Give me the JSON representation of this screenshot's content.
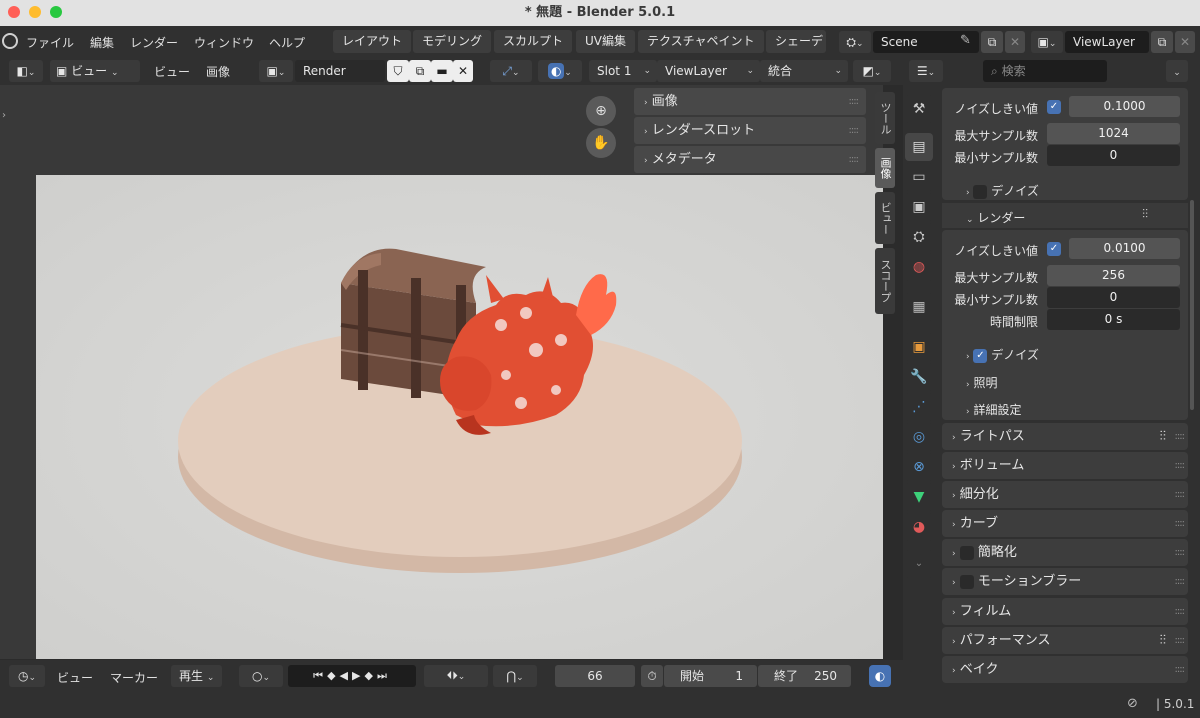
{
  "window": {
    "title": "* 無題 - Blender 5.0.1"
  },
  "menu": [
    "ファイル",
    "編集",
    "レンダー",
    "ウィンドウ",
    "ヘルプ"
  ],
  "workspaces": [
    "レイアウト",
    "モデリング",
    "スカルプト",
    "UV編集",
    "テクスチャペイント",
    "シェーデ"
  ],
  "scene": {
    "label": "Scene",
    "viewlayer": "ViewLayer"
  },
  "image_header": {
    "view_mode": "ビュー",
    "menus": [
      "ビュー",
      "画像"
    ],
    "image_name": "Render Result",
    "slot": "Slot 1",
    "layer": "ViewLayer",
    "pass": "統合"
  },
  "npanel": {
    "items": [
      "画像",
      "レンダースロット",
      "メタデータ"
    ],
    "tabs": [
      "ツール",
      "画像",
      "ビュー",
      "スコープ"
    ]
  },
  "timeline": {
    "menus": [
      "ビュー",
      "マーカー"
    ],
    "playback": "再生",
    "current_frame": "66",
    "start_label": "開始",
    "start": "1",
    "end_label": "終了",
    "end": "250"
  },
  "properties": {
    "search_placeholder": "検索",
    "viewport": {
      "noise_label": "ノイズしきい値",
      "noise": "0.1000",
      "max_label": "最大サンプル数",
      "max": "1024",
      "min_label": "最小サンプル数",
      "min": "0",
      "denoise": "デノイズ"
    },
    "render_header": "レンダー",
    "render": {
      "noise_label": "ノイズしきい値",
      "noise": "0.0100",
      "max_label": "最大サンプル数",
      "max": "256",
      "min_label": "最小サンプル数",
      "min": "0",
      "time_label": "時間制限",
      "time": "0 s",
      "denoise": "デノイズ"
    },
    "subsections": [
      "照明",
      "詳細設定"
    ],
    "sections": [
      "ライトパス",
      "ボリューム",
      "細分化",
      "カーブ",
      "簡略化",
      "モーションブラー",
      "フィルム",
      "パフォーマンス",
      "ベイク"
    ]
  },
  "status": {
    "version": "5.0.1"
  }
}
